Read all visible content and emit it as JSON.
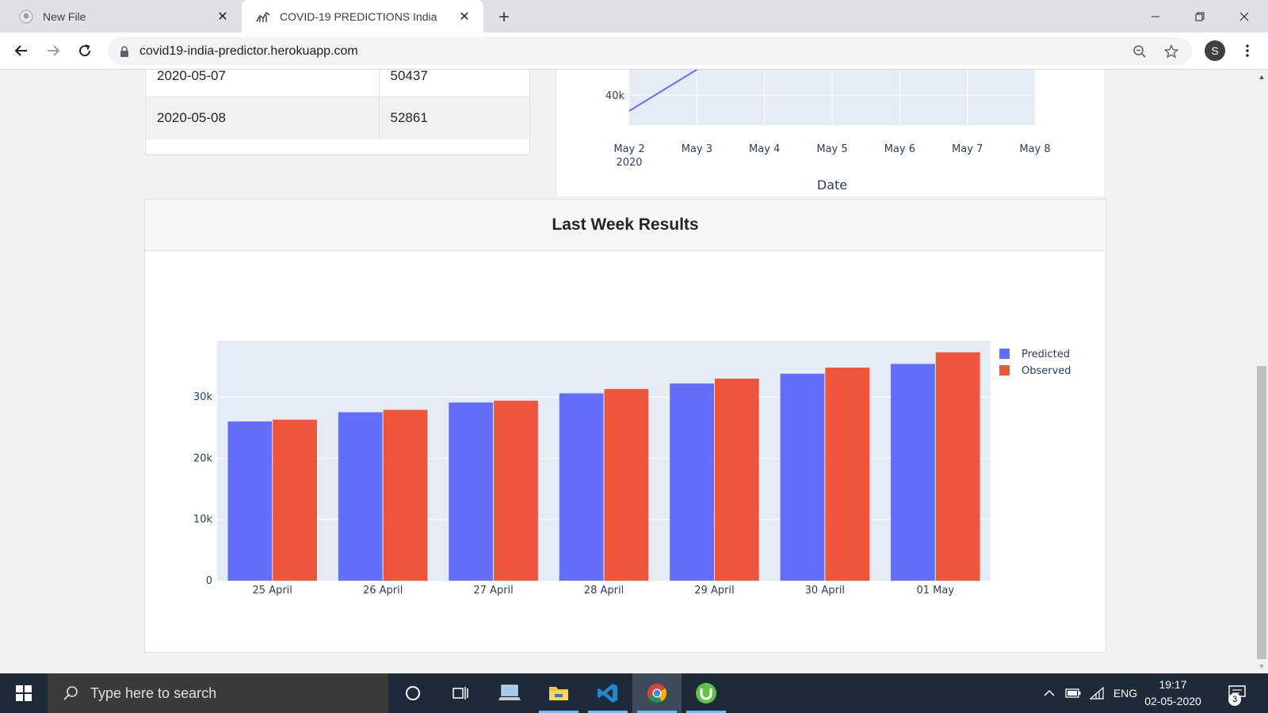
{
  "browser": {
    "tabs": [
      {
        "title": "New File",
        "icon": "github-icon",
        "active": false
      },
      {
        "title": "COVID-19 PREDICTIONS India",
        "icon": "chart-line-icon",
        "active": true
      }
    ],
    "url": "covid19-india-predictor.herokuapp.com",
    "profile_initial": "S"
  },
  "predictions_table": {
    "rows": [
      {
        "date": "2020-05-07",
        "value": "50437"
      },
      {
        "date": "2020-05-08",
        "value": "52861"
      }
    ]
  },
  "forecast_chart": {
    "y_tick": "40k",
    "x_ticks": [
      "May 2",
      "May 3",
      "May 4",
      "May 5",
      "May 6",
      "May 7",
      "May 8"
    ],
    "x_year": "2020",
    "xlabel": "Date",
    "line_color": "#636efa"
  },
  "results": {
    "title": "Last Week Results"
  },
  "chart_data": {
    "type": "bar",
    "categories": [
      "25 April",
      "26 April",
      "27 April",
      "28 April",
      "29 April",
      "30 April",
      "01 May"
    ],
    "series": [
      {
        "name": "Predicted",
        "color": "#636efa",
        "values": [
          26000,
          27500,
          29100,
          30600,
          32200,
          33800,
          35400
        ]
      },
      {
        "name": "Observed",
        "color": "#ef553b",
        "values": [
          26300,
          27900,
          29400,
          31300,
          33000,
          34800,
          37300
        ]
      }
    ],
    "yticks": [
      "0",
      "10k",
      "20k",
      "30k"
    ],
    "ytick_values": [
      0,
      10000,
      20000,
      30000
    ],
    "ylim": [
      0,
      39200
    ],
    "legend_position": "top-right",
    "grid": true,
    "plot_bg": "#e5ecf6"
  },
  "taskbar": {
    "search_placeholder": "Type here to search",
    "language": "ENG",
    "time": "19:17",
    "date": "02-05-2020",
    "notification_count": "3"
  }
}
